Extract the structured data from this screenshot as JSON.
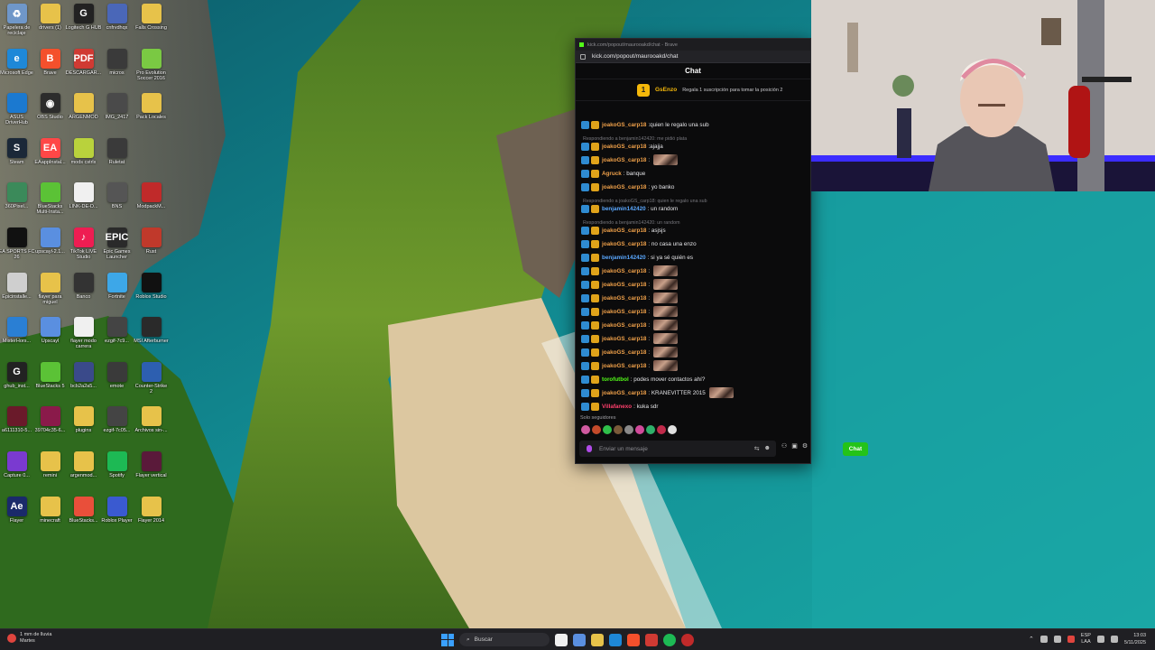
{
  "desktop_icons": [
    {
      "label": "Papelera de reciclaje",
      "color": "#6f97c9",
      "glyph": "♻"
    },
    {
      "label": "drivers (1)",
      "color": "#e7c24a",
      "glyph": ""
    },
    {
      "label": "Logitech G HUB",
      "color": "#222222",
      "glyph": "G"
    },
    {
      "label": "cnfrvdhqx",
      "color": "#4a67b8",
      "glyph": ""
    },
    {
      "label": "Falls Crossing",
      "color": "#e7c24a",
      "glyph": ""
    },
    {
      "label": "Microsoft Edge",
      "color": "#1e88d8",
      "glyph": "e"
    },
    {
      "label": "Brave",
      "color": "#f4502c",
      "glyph": "B"
    },
    {
      "label": "DESCARGAR...",
      "color": "#d03a33",
      "glyph": "PDF"
    },
    {
      "label": "micros",
      "color": "#3a3a3a",
      "glyph": ""
    },
    {
      "label": "Pro Evolution Soccer 2016",
      "color": "#7ac943",
      "glyph": ""
    },
    {
      "label": "ASUS DriverHub",
      "color": "#1b79d0",
      "glyph": ""
    },
    {
      "label": "OBS Studio",
      "color": "#2c2c2c",
      "glyph": "◉"
    },
    {
      "label": "ARGENMOD",
      "color": "#e7c24a",
      "glyph": ""
    },
    {
      "label": "IMG_2417",
      "color": "#4a4a4a",
      "glyph": ""
    },
    {
      "label": "Pack Locales",
      "color": "#e7c24a",
      "glyph": ""
    },
    {
      "label": "Steam",
      "color": "#1b2838",
      "glyph": "S"
    },
    {
      "label": "EAappInstal...",
      "color": "#ff4747",
      "glyph": "EA"
    },
    {
      "label": "mods cstrlx",
      "color": "#b9d23c",
      "glyph": ""
    },
    {
      "label": "Ruletat",
      "color": "#3a3a3a",
      "glyph": ""
    },
    {
      "label": "",
      "color": "",
      "glyph": ""
    },
    {
      "label": "360Pixel...",
      "color": "#3b8a5a",
      "glyph": ""
    },
    {
      "label": "BlueStacks Multi-Insta...",
      "color": "#5bc236",
      "glyph": ""
    },
    {
      "label": "LINK-DE-D...",
      "color": "#f0f0f0",
      "glyph": ""
    },
    {
      "label": "BNS",
      "color": "#555555",
      "glyph": ""
    },
    {
      "label": "ModpackM...",
      "color": "#c02a2a",
      "glyph": ""
    },
    {
      "label": "EA SPORTS FC 26",
      "color": "#111111",
      "glyph": ""
    },
    {
      "label": "upscayl-2.1...",
      "color": "#5a8fe0",
      "glyph": ""
    },
    {
      "label": "TikTok LIVE Studio",
      "color": "#ee1d52",
      "glyph": "♪"
    },
    {
      "label": "Epic Games Launcher",
      "color": "#2a2a2a",
      "glyph": "EPIC"
    },
    {
      "label": "Rust",
      "color": "#c0392b",
      "glyph": ""
    },
    {
      "label": "Epicinstalle...",
      "color": "#cfcfcf",
      "glyph": ""
    },
    {
      "label": "flayer para miguel",
      "color": "#e7c24a",
      "glyph": ""
    },
    {
      "label": "Banco",
      "color": "#333333",
      "glyph": ""
    },
    {
      "label": "Fortnite",
      "color": "#3da7e8",
      "glyph": ""
    },
    {
      "label": "Roblox Studio",
      "color": "#111111",
      "glyph": ""
    },
    {
      "label": "MisterHors...",
      "color": "#2a7fd4",
      "glyph": ""
    },
    {
      "label": "Upscayl",
      "color": "#5a8fe0",
      "glyph": ""
    },
    {
      "label": "flayer modo carrera",
      "color": "#f0f0f0",
      "glyph": ""
    },
    {
      "label": "ezgif-7c9...",
      "color": "#444444",
      "glyph": ""
    },
    {
      "label": "MSI Afterburner",
      "color": "#2a2a2a",
      "glyph": ""
    },
    {
      "label": "ghub_inst...",
      "color": "#222222",
      "glyph": "G"
    },
    {
      "label": "BlueStacks 5",
      "color": "#5bc236",
      "glyph": ""
    },
    {
      "label": "bcb2a2a5...",
      "color": "#3a4a8a",
      "glyph": ""
    },
    {
      "label": "emote",
      "color": "#3a3a3a",
      "glyph": ""
    },
    {
      "label": "Counter-Strike 2",
      "color": "#2d5fb0",
      "glyph": ""
    },
    {
      "label": "a6111310-5...",
      "color": "#6a1a2a",
      "glyph": ""
    },
    {
      "label": "39704c35-6...",
      "color": "#8a1a4a",
      "glyph": ""
    },
    {
      "label": "plugins",
      "color": "#e7c24a",
      "glyph": ""
    },
    {
      "label": "ezgif-7c05...",
      "color": "#444444",
      "glyph": ""
    },
    {
      "label": "Archivos sin-...",
      "color": "#e7c24a",
      "glyph": ""
    },
    {
      "label": "Capture 0...",
      "color": "#7a3ad0",
      "glyph": ""
    },
    {
      "label": "remini",
      "color": "#e7c24a",
      "glyph": ""
    },
    {
      "label": "argenmod...",
      "color": "#e7c24a",
      "glyph": ""
    },
    {
      "label": "Spotify",
      "color": "#1db954",
      "glyph": ""
    },
    {
      "label": "Flayer vertical",
      "color": "#5a1a3a",
      "glyph": ""
    },
    {
      "label": "Flayer",
      "color": "#1a2a6a",
      "glyph": "Ae"
    },
    {
      "label": "minecraft",
      "color": "#e7c24a",
      "glyph": ""
    },
    {
      "label": "BlueStacks...",
      "color": "#e94f3a",
      "glyph": ""
    },
    {
      "label": "Roblox Player",
      "color": "#3a5ad0",
      "glyph": ""
    },
    {
      "label": "Flayer 2014",
      "color": "#e7c24a",
      "glyph": ""
    }
  ],
  "browser": {
    "title": "kick.com/popout/maurooakd/chat - Brave",
    "url": "kick.com/popout/maurooakd/chat"
  },
  "chat": {
    "header": "Chat",
    "pinned_user": "GsEnzo",
    "pinned_rank": "1",
    "pinned_promo": "Regala 1 suscripción para tomar la posición 2",
    "followers_only": "Solo seguidores",
    "input_placeholder": "Enviar un mensaje",
    "send_label": "Chat",
    "colors": {
      "joako": "#f0a14a",
      "benjamin": "#5aa8ff",
      "agruck": "#f0a14a",
      "toro": "#53fc18",
      "villa": "#ff3f6c"
    },
    "messages": [
      {
        "user": "joakoGS_carp18",
        "text": ":quien le regalo una sub",
        "color": "#f0a14a",
        "emote": false
      },
      {
        "reply": "Respondiendo a benjamin142420: me pidió plata"
      },
      {
        "user": "joakoGS_carp18",
        "text": ":ajajja",
        "color": "#f0a14a",
        "emote": false
      },
      {
        "user": "joakoGS_carp18",
        "text": ":",
        "color": "#f0a14a",
        "emote": true
      },
      {
        "user": "Agruck",
        "text": ": banque",
        "color": "#f0a14a",
        "emote": false
      },
      {
        "user": "joakoGS_carp18",
        "text": ": yo banko",
        "color": "#f0a14a",
        "emote": false
      },
      {
        "reply": "Respondiendo a joakoGS_carp18: quien le regalo una sub"
      },
      {
        "user": "benjamin142420",
        "text": ": un random",
        "color": "#5aa8ff",
        "emote": false
      },
      {
        "reply": "Respondiendo a benjamin142420: un random"
      },
      {
        "user": "joakoGS_carp18",
        "text": ": asjsjs",
        "color": "#f0a14a",
        "emote": false
      },
      {
        "user": "joakoGS_carp18",
        "text": ": no casa una enzo",
        "color": "#f0a14a",
        "emote": false
      },
      {
        "user": "benjamin142420",
        "text": ": si ya sé quién es",
        "color": "#5aa8ff",
        "emote": false
      },
      {
        "user": "joakoGS_carp18",
        "text": ":",
        "color": "#f0a14a",
        "emote": true
      },
      {
        "user": "joakoGS_carp18",
        "text": ":",
        "color": "#f0a14a",
        "emote": true
      },
      {
        "user": "joakoGS_carp18",
        "text": ":",
        "color": "#f0a14a",
        "emote": true
      },
      {
        "user": "joakoGS_carp18",
        "text": ":",
        "color": "#f0a14a",
        "emote": true
      },
      {
        "user": "joakoGS_carp18",
        "text": ":",
        "color": "#f0a14a",
        "emote": true
      },
      {
        "user": "joakoGS_carp18",
        "text": ":",
        "color": "#f0a14a",
        "emote": true
      },
      {
        "user": "joakoGS_carp18",
        "text": ":",
        "color": "#f0a14a",
        "emote": true
      },
      {
        "user": "joakoGS_carp18",
        "text": ":",
        "color": "#f0a14a",
        "emote": true
      },
      {
        "user": "torofutbol",
        "text": ": podes mover contactos ahí?",
        "color": "#53fc18",
        "emote": false
      },
      {
        "user": "joakoGS_carp18",
        "text": ": KRANEVITTER 2015",
        "color": "#f0a14a",
        "emote": true
      },
      {
        "user": "Villafanexo",
        "text": ": kuka sdr",
        "color": "#ff3f6c",
        "emote": false
      }
    ]
  },
  "taskbar": {
    "weather_line1": "1 mm de lluvia",
    "weather_line2": "Martes",
    "search": "Buscar",
    "lang_line1": "ESP",
    "lang_line2": "LAA",
    "time": "13:03",
    "date": "5/11/2025"
  }
}
